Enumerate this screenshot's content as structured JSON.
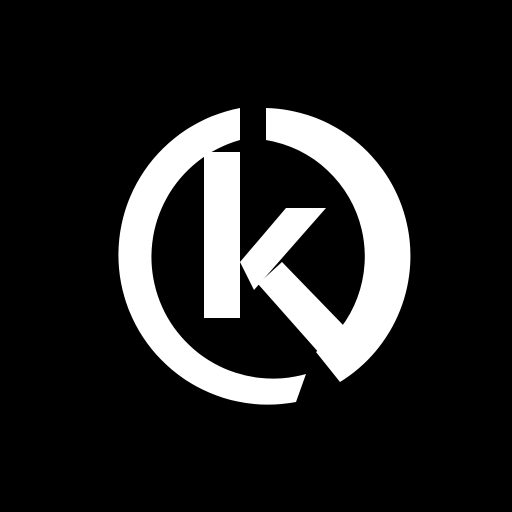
{
  "logo": {
    "name": "k-circle-logo",
    "letter": "k",
    "colors": {
      "background": "#000000",
      "foreground": "#ffffff"
    }
  }
}
